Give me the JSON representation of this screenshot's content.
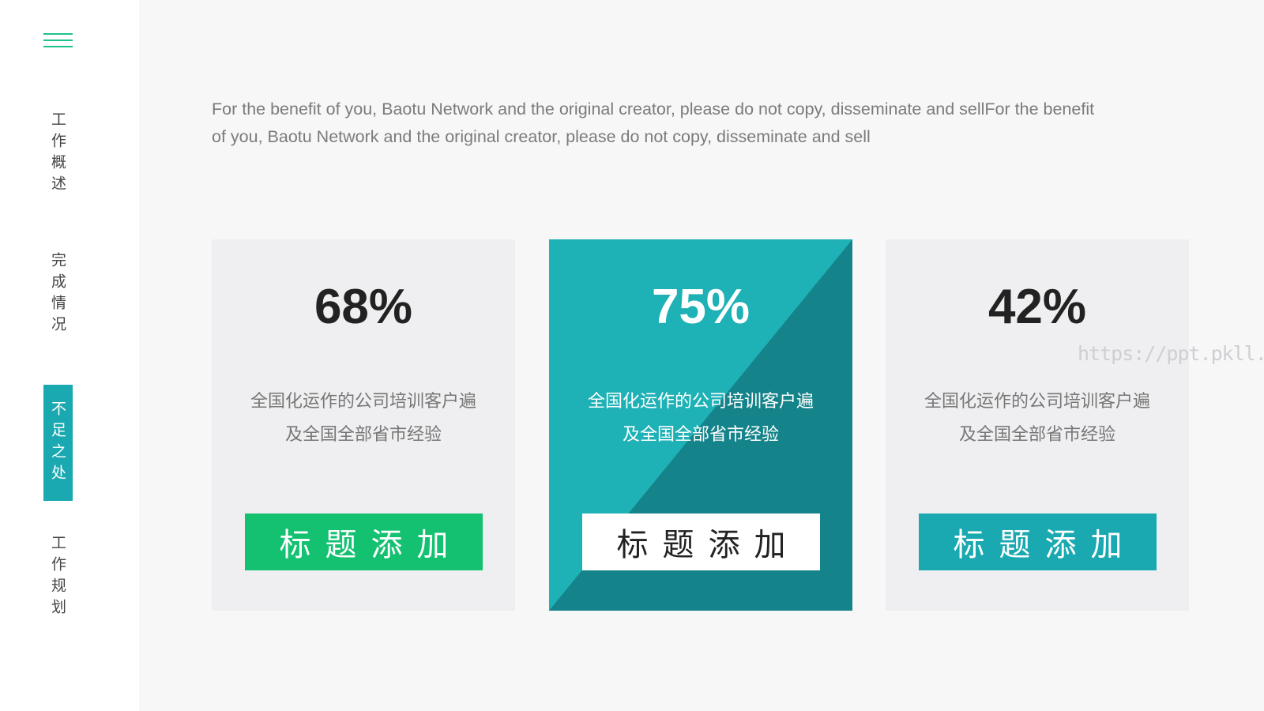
{
  "sidebar": {
    "items": [
      {
        "label": "工作概述",
        "active": false
      },
      {
        "label": "完成情况",
        "active": false
      },
      {
        "label": "不足之处",
        "active": true
      },
      {
        "label": "工作规划",
        "active": false
      }
    ]
  },
  "intro": {
    "text": "For the benefit of you, Baotu Network and the original creator, please do not copy, disseminate and sellFor the benefit of you, Baotu Network and the original creator, please do not copy, disseminate and sell"
  },
  "cards": [
    {
      "percent": "68%",
      "value": 68,
      "desc_line1": "全国化运作的公司培训客户遍",
      "desc_line2": "及全国全部省市经验",
      "button": "标题添加",
      "button_color": "#13c171"
    },
    {
      "percent": "75%",
      "value": 75,
      "desc_line1": "全国化运作的公司培训客户遍",
      "desc_line2": "及全国全部省市经验",
      "button": "标题添加",
      "button_color": "#ffffff"
    },
    {
      "percent": "42%",
      "value": 42,
      "desc_line1": "全国化运作的公司培训客户遍",
      "desc_line2": "及全国全部省市经验",
      "button": "标题添加",
      "button_color": "#1aa9b0"
    }
  ],
  "watermark": "https://ppt.pkll.de",
  "colors": {
    "accent_green": "#13c171",
    "accent_teal": "#1aa9b0",
    "teal_dark": "#15838a",
    "menu_icon": "#1ec28b"
  },
  "icons": {
    "menu": "hamburger-menu-icon"
  }
}
